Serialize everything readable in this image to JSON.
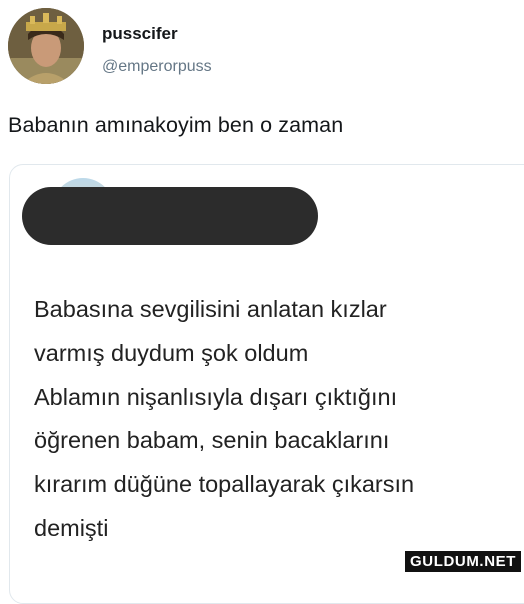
{
  "tweet": {
    "author_name": "pusscifer",
    "author_handle": "@emperorpuss",
    "text": "Babanın amınakoyim ben o zaman"
  },
  "quoted_tweet": {
    "lines": [
      "Babasına sevgilisini anlatan kızlar",
      "varmış duydum şok oldum",
      "Ablamın nişanlısıyla dışarı çıktığını",
      "öğrenen babam, senin bacaklarını",
      "kırarım düğüne topallayarak çıkarsın",
      "demişti"
    ]
  },
  "watermark": "GULDUM.NET",
  "colors": {
    "text": "#14171a",
    "secondary": "#657786",
    "border": "#e1e8ed",
    "redaction": "#2c2c2c"
  }
}
